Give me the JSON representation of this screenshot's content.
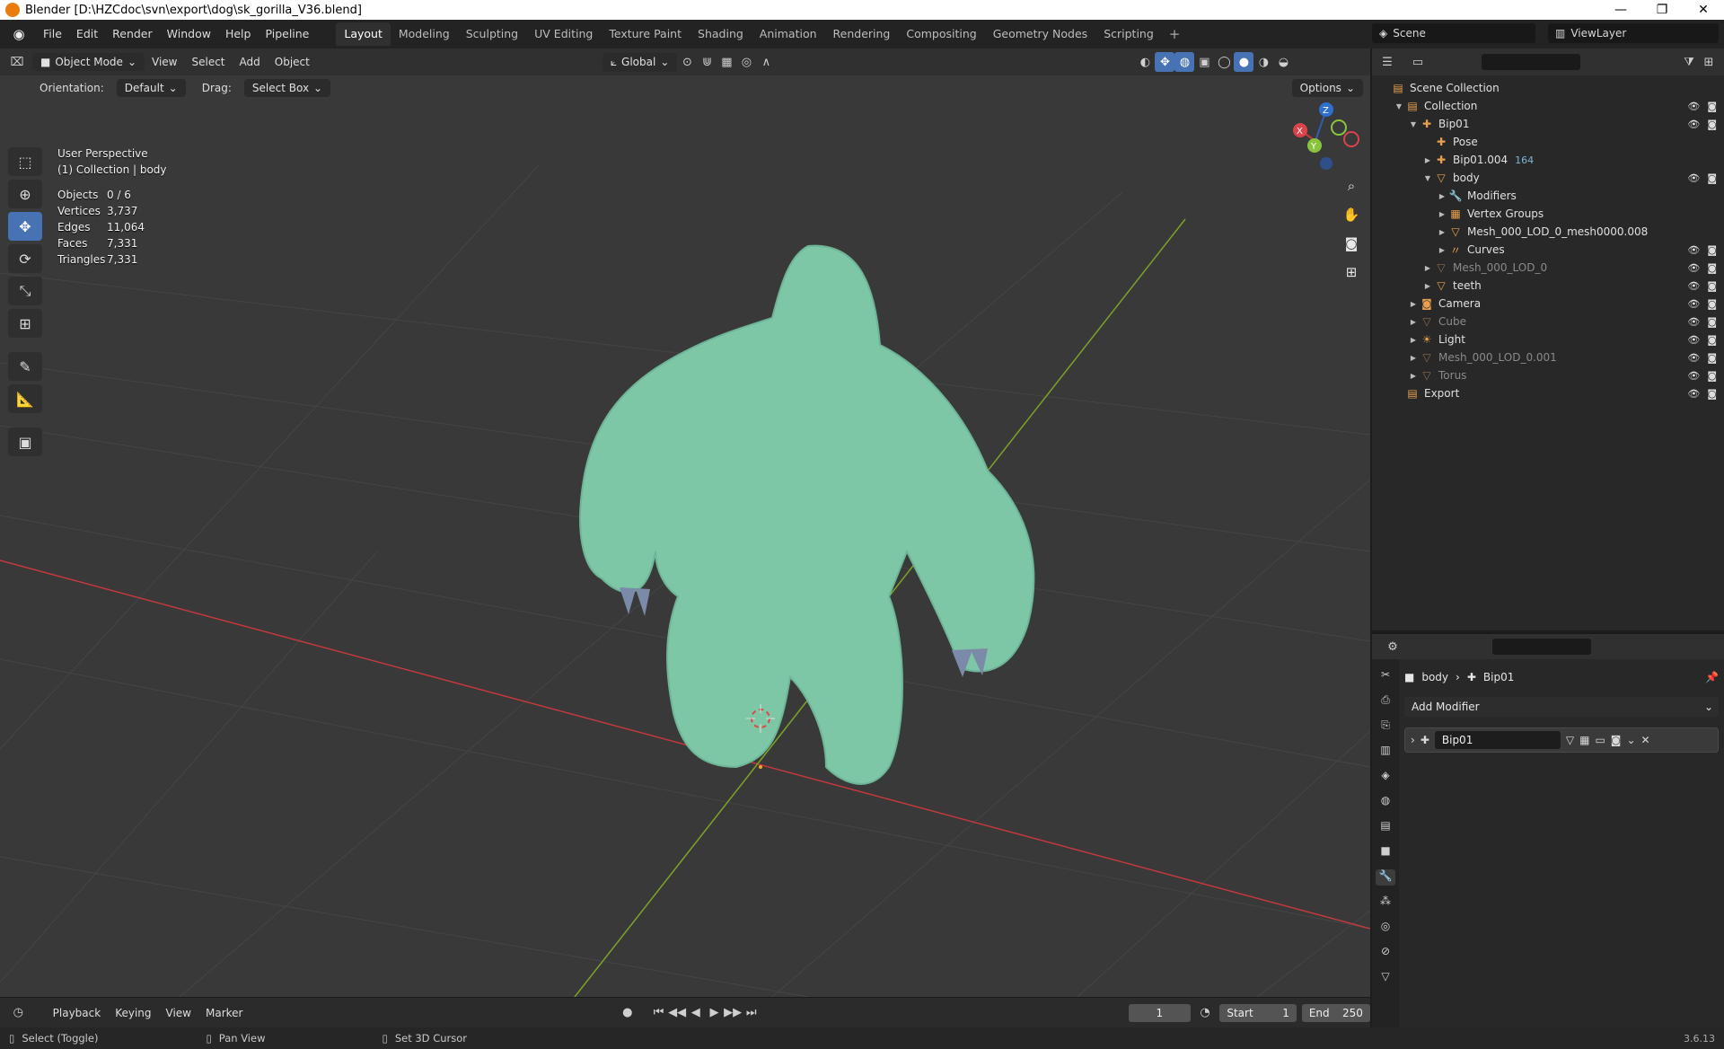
{
  "window": {
    "title": "Blender [D:\\HZCdoc\\svn\\export\\dog\\sk_gorilla_V36.blend]",
    "controls": [
      "—",
      "❐",
      "✕"
    ]
  },
  "menu": [
    "File",
    "Edit",
    "Render",
    "Window",
    "Help",
    "Pipeline"
  ],
  "workspaces": [
    "Layout",
    "Modeling",
    "Sculpting",
    "UV Editing",
    "Texture Paint",
    "Shading",
    "Animation",
    "Rendering",
    "Compositing",
    "Geometry Nodes",
    "Scripting"
  ],
  "workspace_add": "+",
  "scene": "Scene",
  "view_layer": "ViewLayer",
  "viewport": {
    "mode": "Object Mode",
    "menus": [
      "View",
      "Select",
      "Add",
      "Object"
    ],
    "transform_orientation": "Global",
    "orientation_label": "Orientation:",
    "orientation_value": "Default",
    "drag_label": "Drag:",
    "drag_value": "Select Box",
    "options_label": "Options",
    "perspective": "User Perspective",
    "context": "(1) Collection | body",
    "stats": [
      {
        "k": "Objects",
        "v": "0 / 6"
      },
      {
        "k": "Vertices",
        "v": "3,737"
      },
      {
        "k": "Edges",
        "v": "11,064"
      },
      {
        "k": "Faces",
        "v": "7,331"
      },
      {
        "k": "Triangles",
        "v": "7,331"
      }
    ],
    "gizmo_axes": {
      "z": "Z",
      "x": "X",
      "y": "Y"
    },
    "colors": {
      "background": "#393939",
      "fur": "#7dc6a6",
      "x_axis": "#c5393e",
      "y_axis": "#7ba328"
    }
  },
  "outliner": {
    "rows": [
      {
        "label": "Scene Collection",
        "icon": "▤",
        "depth": 0,
        "arrow": "",
        "dim": false,
        "vis": false
      },
      {
        "label": "Collection",
        "icon": "▤",
        "depth": 1,
        "arrow": "▼",
        "dim": false,
        "vis": true
      },
      {
        "label": "Bip01",
        "icon": "✚",
        "depth": 2,
        "arrow": "▼",
        "dim": false,
        "vis": true
      },
      {
        "label": "Pose",
        "icon": "✚",
        "depth": 3,
        "arrow": "",
        "dim": false,
        "vis": false
      },
      {
        "label": "Bip01.004",
        "icon": "✚",
        "depth": 3,
        "arrow": "▶",
        "dim": false,
        "vis": false,
        "extra": "164"
      },
      {
        "label": "body",
        "icon": "▽",
        "depth": 3,
        "arrow": "▼",
        "dim": false,
        "vis": true
      },
      {
        "label": "Modifiers",
        "icon": "🔧",
        "depth": 4,
        "arrow": "▶",
        "dim": false,
        "vis": false
      },
      {
        "label": "Vertex Groups",
        "icon": "▦",
        "depth": 4,
        "arrow": "▶",
        "dim": false,
        "vis": false
      },
      {
        "label": "Mesh_000_LOD_0_mesh0000.008",
        "icon": "▽",
        "depth": 4,
        "arrow": "▶",
        "dim": false,
        "vis": false
      },
      {
        "label": "Curves",
        "icon": "〃",
        "depth": 4,
        "arrow": "▶",
        "dim": false,
        "vis": true
      },
      {
        "label": "Mesh_000_LOD_0",
        "icon": "▽",
        "depth": 3,
        "arrow": "▶",
        "dim": true,
        "vis": true
      },
      {
        "label": "teeth",
        "icon": "▽",
        "depth": 3,
        "arrow": "▶",
        "dim": false,
        "vis": true
      },
      {
        "label": "Camera",
        "icon": "◙",
        "depth": 2,
        "arrow": "▶",
        "dim": false,
        "vis": true
      },
      {
        "label": "Cube",
        "icon": "▽",
        "depth": 2,
        "arrow": "▶",
        "dim": true,
        "vis": true
      },
      {
        "label": "Light",
        "icon": "☀",
        "depth": 2,
        "arrow": "▶",
        "dim": false,
        "vis": true
      },
      {
        "label": "Mesh_000_LOD_0.001",
        "icon": "▽",
        "depth": 2,
        "arrow": "▶",
        "dim": true,
        "vis": true
      },
      {
        "label": "Torus",
        "icon": "▽",
        "depth": 2,
        "arrow": "▶",
        "dim": true,
        "vis": true
      },
      {
        "label": "Export",
        "icon": "▤",
        "depth": 1,
        "arrow": "",
        "dim": false,
        "vis": true
      }
    ]
  },
  "properties": {
    "breadcrumb_object": "body",
    "breadcrumb_sep": "›",
    "breadcrumb_modifier": "Bip01",
    "add_modifier": "Add Modifier",
    "modifier_name": "Bip01"
  },
  "timeline": {
    "menus": [
      "Playback",
      "Keying",
      "View",
      "Marker"
    ],
    "current_frame": "1",
    "start_label": "Start",
    "start": "1",
    "end_label": "End",
    "end": "250"
  },
  "status": {
    "select": "Select (Toggle)",
    "pan": "Pan View",
    "cursor": "Set 3D Cursor",
    "version": "3.6.13"
  }
}
